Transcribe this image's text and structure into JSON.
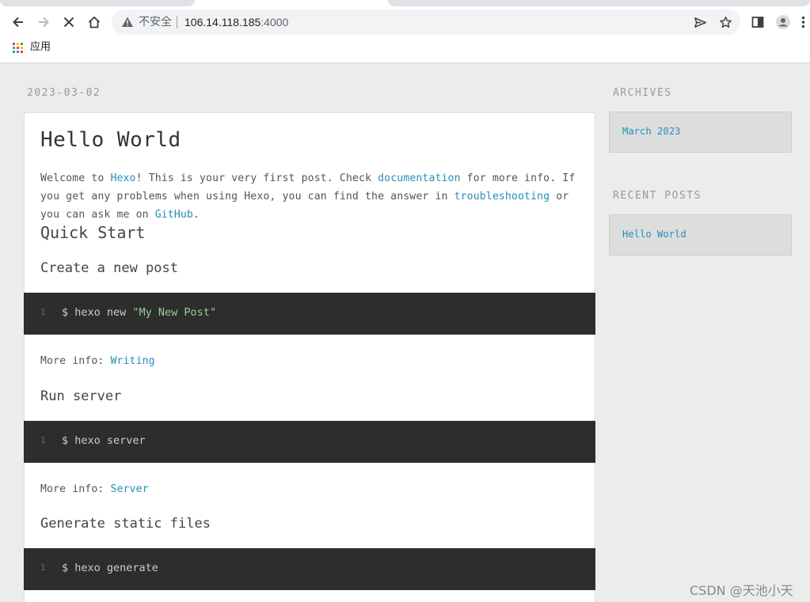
{
  "browser": {
    "omnibox": {
      "security_label": "不安全",
      "host": "106.14.118.185",
      "port": ":4000"
    },
    "bookmarks_bar": {
      "apps_label": "应用"
    },
    "icons": {
      "back": "arrow-left-icon",
      "forward": "arrow-right-icon",
      "stop": "close-icon",
      "home": "home-icon",
      "warning": "warning-triangle-icon",
      "send": "send-icon",
      "bookmark": "star-icon",
      "side_panel": "side-panel-icon",
      "profile": "profile-avatar-icon",
      "menu": "kebab-menu-icon"
    }
  },
  "post": {
    "date": "2023-03-02",
    "title": "Hello World",
    "intro": {
      "t1": "Welcome to ",
      "link_hexo": "Hexo",
      "t2": "! This is your very first post. Check ",
      "link_docs": "documentation",
      "t3": " for more info. If you get any problems when using Hexo, you can find the answer in ",
      "link_trouble": "troubleshooting",
      "t4": " or you can ask me on ",
      "link_github": "GitHub",
      "t5": "."
    },
    "quick_start": "Quick Start",
    "sections": [
      {
        "heading": "Create a new post",
        "line_no": "1",
        "cmd_prefix": "$ hexo new ",
        "cmd_string": "\"My New Post\"",
        "more_label": "More info: ",
        "more_link": "Writing"
      },
      {
        "heading": "Run server",
        "line_no": "1",
        "cmd_prefix": "$ hexo server",
        "cmd_string": "",
        "more_label": "More info: ",
        "more_link": "Server"
      },
      {
        "heading": "Generate static files",
        "line_no": "1",
        "cmd_prefix": "$ hexo generate",
        "cmd_string": ""
      }
    ]
  },
  "sidebar": {
    "archives_title": "ARCHIVES",
    "archives_items": [
      "March 2023"
    ],
    "recent_title": "RECENT POSTS",
    "recent_items": [
      "Hello World"
    ]
  },
  "watermark": "CSDN @天池小天",
  "colors": {
    "link": "#258fb8",
    "code_bg": "#2d2d2d",
    "code_string": "#99cc99",
    "page_bg": "#ececec"
  }
}
